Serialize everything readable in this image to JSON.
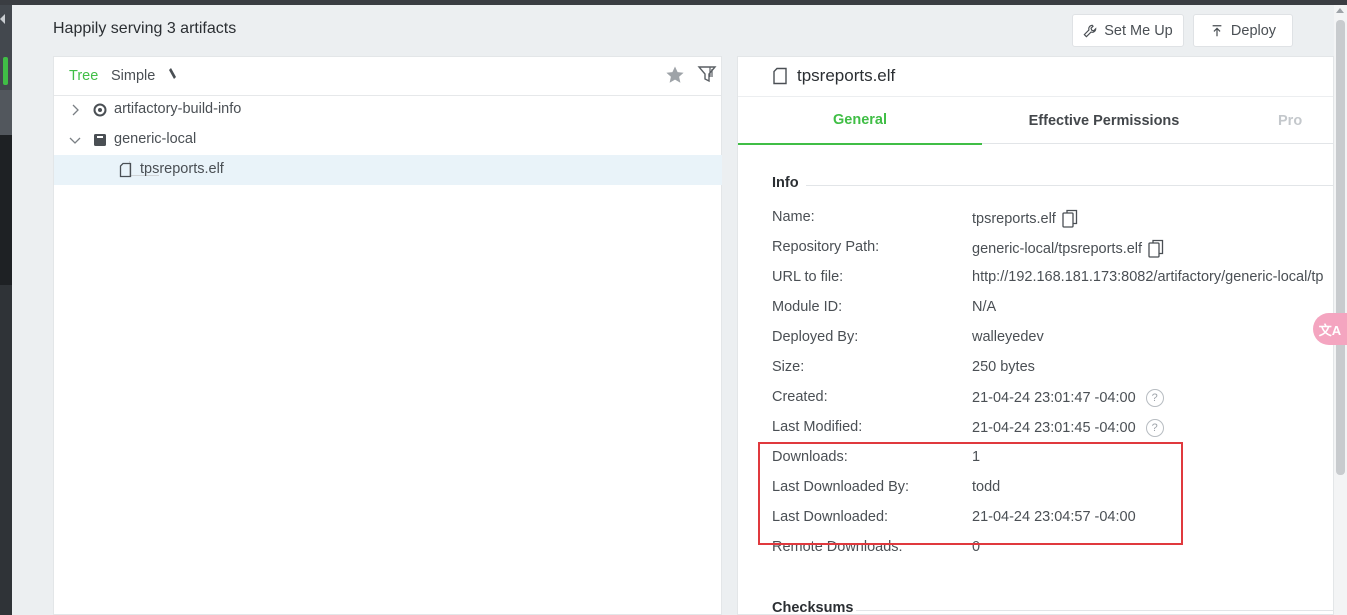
{
  "header": {
    "title": "Happily serving 3 artifacts",
    "set_me_up_label": "Set Me Up",
    "deploy_label": "Deploy"
  },
  "tree": {
    "tabs": {
      "tree_label": "Tree",
      "simple_label": "Simple"
    },
    "items": [
      {
        "label": "artifactory-build-info",
        "icon": "build-info-icon",
        "expanded": false
      },
      {
        "label": "generic-local",
        "icon": "repository-icon",
        "expanded": true
      },
      {
        "label": "tpsreports.elf",
        "icon": "file-icon",
        "selected": true
      }
    ]
  },
  "detail": {
    "title": "tpsreports.elf",
    "tabs": {
      "general": "General",
      "permissions": "Effective Permissions",
      "properties": "Pro"
    },
    "info_section": "Info",
    "checksums_section": "Checksums",
    "info": {
      "name_label": "Name:",
      "name_value": "tpsreports.elf",
      "repo_path_label": "Repository Path:",
      "repo_path_value": "generic-local/tpsreports.elf",
      "url_label": "URL to file:",
      "url_value": "http://192.168.181.173:8082/artifactory/generic-local/tp",
      "module_label": "Module ID:",
      "module_value": "N/A",
      "deployed_by_label": "Deployed By:",
      "deployed_by_value": "walleyedev",
      "size_label": "Size:",
      "size_value": "250 bytes",
      "created_label": "Created:",
      "created_value": "21-04-24 23:01:47 -04:00",
      "modified_label": "Last Modified:",
      "modified_value": "21-04-24 23:01:45 -04:00",
      "downloads_label": "Downloads:",
      "downloads_value": "1",
      "last_dl_by_label": "Last Downloaded By:",
      "last_dl_by_value": "todd",
      "last_dl_label": "Last Downloaded:",
      "last_dl_value": "21-04-24 23:04:57 -04:00",
      "remote_dl_label": "Remote Downloads:",
      "remote_dl_value": "0"
    },
    "help_glyph": "?"
  },
  "translate_fab": "文A",
  "colors": {
    "accent": "#40be46",
    "highlight": "#e0393e"
  }
}
